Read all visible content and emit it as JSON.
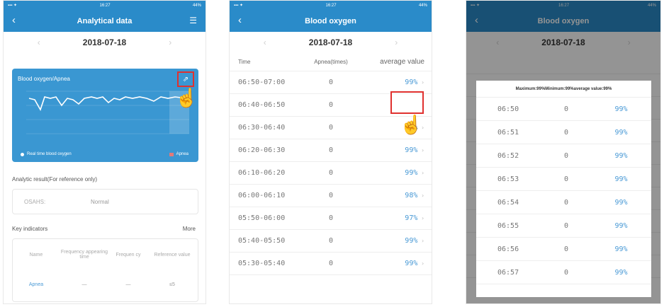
{
  "screen1": {
    "title": "Analytical data",
    "date": "2018-07-18",
    "chart_title": "Blood oxygen/Apnea",
    "legend_spo2": "Real time blood oxygen",
    "legend_apnea": "Apnea",
    "analytic_label": "Analytic result(For reference only)",
    "result_key": "OSAHS:",
    "result_value": "Normal",
    "key_indicators": "Key indicators",
    "more": "More",
    "ind_headers": [
      "Name",
      "Frequency appearing time",
      "Frequen cy",
      "Reference value"
    ],
    "ind_row": [
      "Apnea",
      "—",
      "—",
      "≤5"
    ]
  },
  "screen2": {
    "title": "Blood oxygen",
    "date": "2018-07-18",
    "headers": [
      "Time",
      "Apnea(times)",
      "average value"
    ],
    "rows": [
      {
        "time": "06:50-07:00",
        "apnea": "0",
        "avg": "99%"
      },
      {
        "time": "06:40-06:50",
        "apnea": "0",
        "avg": ""
      },
      {
        "time": "06:30-06:40",
        "apnea": "0",
        "avg": "99%"
      },
      {
        "time": "06:20-06:30",
        "apnea": "0",
        "avg": "99%"
      },
      {
        "time": "06:10-06:20",
        "apnea": "0",
        "avg": "99%"
      },
      {
        "time": "06:00-06:10",
        "apnea": "0",
        "avg": "98%"
      },
      {
        "time": "05:50-06:00",
        "apnea": "0",
        "avg": "97%"
      },
      {
        "time": "05:40-05:50",
        "apnea": "0",
        "avg": "99%"
      },
      {
        "time": "05:30-05:40",
        "apnea": "0",
        "avg": "99%"
      }
    ]
  },
  "screen3": {
    "title": "Blood oxygen",
    "date": "2018-07-18",
    "popup_header": "Maximum:99%Minimum:99%average value:99%",
    "rows": [
      {
        "time": "06:50",
        "apnea": "0",
        "avg": "99%"
      },
      {
        "time": "06:51",
        "apnea": "0",
        "avg": "99%"
      },
      {
        "time": "06:52",
        "apnea": "0",
        "avg": "99%"
      },
      {
        "time": "06:53",
        "apnea": "0",
        "avg": "99%"
      },
      {
        "time": "06:54",
        "apnea": "0",
        "avg": "99%"
      },
      {
        "time": "06:55",
        "apnea": "0",
        "avg": "99%"
      },
      {
        "time": "06:56",
        "apnea": "0",
        "avg": "99%"
      },
      {
        "time": "06:57",
        "apnea": "0",
        "avg": "99%"
      }
    ]
  },
  "status": {
    "time": "16:27",
    "battery": "44%"
  },
  "colors": {
    "primary": "#2a8bc9",
    "accent": "#4a9ad6",
    "highlight": "#e0312f"
  }
}
